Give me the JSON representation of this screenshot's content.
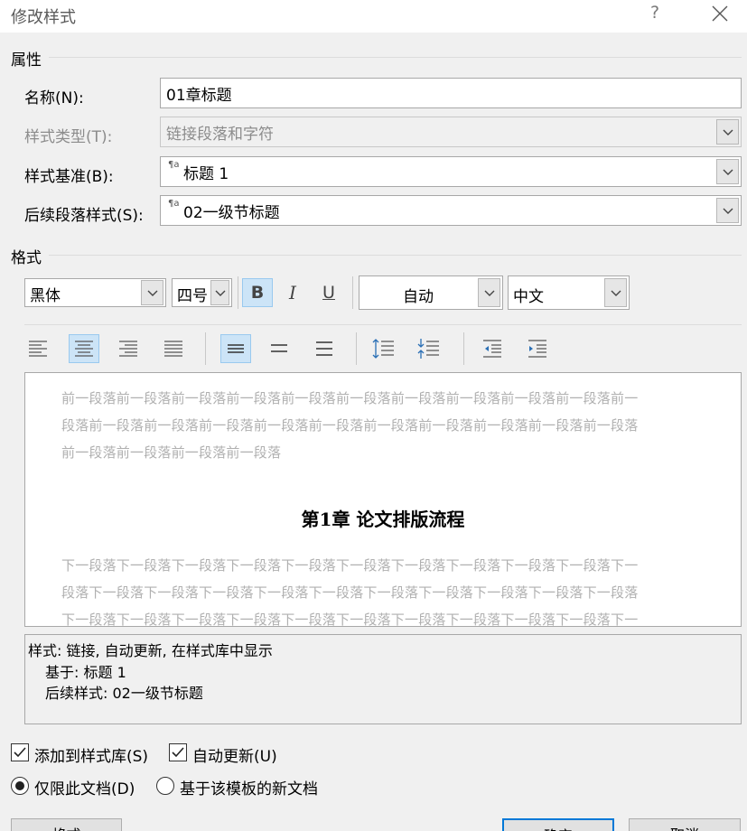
{
  "window": {
    "title": "修改样式",
    "help": "?"
  },
  "properties": {
    "heading": "属性",
    "name_label": "名称(N):",
    "name_value": "01章标题",
    "type_label": "样式类型(T):",
    "type_value": "链接段落和字符",
    "based_label": "样式基准(B):",
    "based_value": "标题 1",
    "next_label": "后续段落样式(S):",
    "next_value": "02一级节标题",
    "para_icon": "¶a"
  },
  "format": {
    "heading": "格式",
    "font": "黑体",
    "size": "四号",
    "bold": "B",
    "italic": "I",
    "underline": "U",
    "color": "自动",
    "script": "中文"
  },
  "preview": {
    "prev_lines": [
      "前一段落前一段落前一段落前一段落前一段落前一段落前一段落前一段落前一段落前一段落前一",
      "段落前一段落前一段落前一段落前一段落前一段落前一段落前一段落前一段落前一段落前一段落",
      "前一段落前一段落前一段落前一段落"
    ],
    "title": "第1章 论文排版流程",
    "next_lines": [
      "下一段落下一段落下一段落下一段落下一段落下一段落下一段落下一段落下一段落下一段落下一",
      "段落下一段落下一段落下一段落下一段落下一段落下一段落下一段落下一段落下一段落下一段落",
      "下一段落下一段落下一段落下一段落下一段落下一段落下一段落下一段落下一段落下一段落下一"
    ]
  },
  "description": {
    "line1": "样式: 链接, 自动更新, 在样式库中显示",
    "line2": "基于: 标题 1",
    "line3": "后续样式: 02一级节标题"
  },
  "options": {
    "add_to_gallery": "添加到样式库(S)",
    "auto_update": "自动更新(U)",
    "only_this_doc": "仅限此文档(D)",
    "new_docs_template": "基于该模板的新文档"
  },
  "buttons": {
    "format": "格式",
    "ok": "确定",
    "cancel": "取消"
  },
  "colors": {
    "accent": "#0078d7",
    "active_button": "#cce4f7"
  }
}
